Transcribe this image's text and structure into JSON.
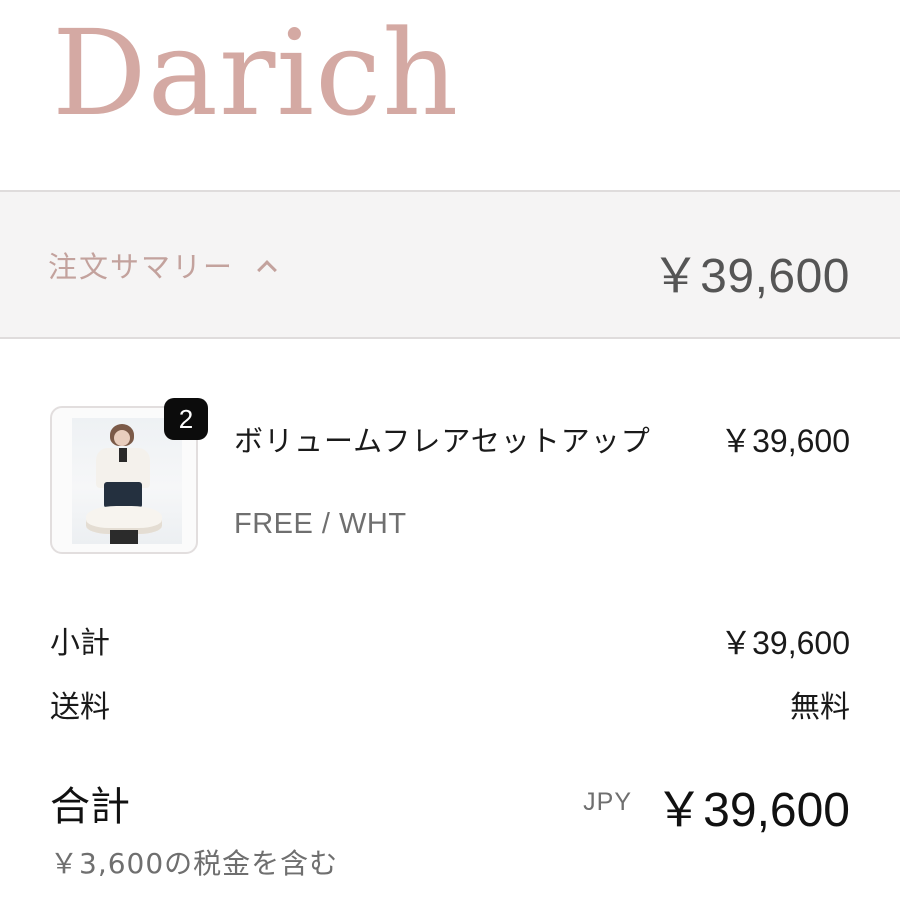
{
  "brand": {
    "logo_text": "Darich",
    "logo_color": "#d4a9a3"
  },
  "summary_bar": {
    "toggle_label": "注文サマリー",
    "toggle_icon": "chevron-up-icon",
    "total": "￥39,600"
  },
  "cart": {
    "items": [
      {
        "quantity": "2",
        "name": "ボリュームフレアセットアップ",
        "variant": "FREE / WHT",
        "price": "￥39,600",
        "thumbnail": "product-photo"
      }
    ]
  },
  "costs": {
    "subtotal_label": "小計",
    "subtotal_value": "￥39,600",
    "shipping_label": "送料",
    "shipping_value": "無料"
  },
  "total": {
    "label": "合計",
    "currency": "JPY",
    "value": "￥39,600",
    "tax_note": "￥3,600の税金を含む"
  },
  "colors": {
    "accent_pink": "#c3a29d",
    "summary_bg": "#f5f4f4",
    "badge_bg": "#0c0c0c"
  }
}
